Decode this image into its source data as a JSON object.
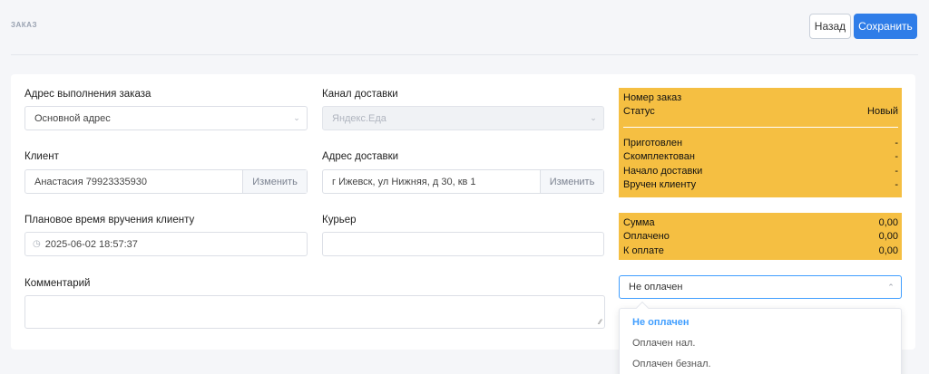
{
  "page": {
    "title": "ЗАКАЗ"
  },
  "actions": {
    "back_label": "Назад",
    "save_label": "Сохранить"
  },
  "form": {
    "fulfillment_address": {
      "label": "Адрес выполнения заказа",
      "value": "Основной адрес"
    },
    "delivery_channel": {
      "label": "Канал доставки",
      "value": "Яндекс.Еда"
    },
    "client": {
      "label": "Клиент",
      "value": "Анастасия 79923335930",
      "change_label": "Изменить"
    },
    "delivery_address": {
      "label": "Адрес доставки",
      "value": "г Ижевск, ул Нижняя, д 30, кв 1",
      "change_label": "Изменить"
    },
    "planned_time": {
      "label": "Плановое время вручения клиенту",
      "value": "2025-06-02 18:57:37"
    },
    "courier": {
      "label": "Курьер",
      "value": ""
    },
    "comment": {
      "label": "Комментарий",
      "value": ""
    }
  },
  "status_panel": {
    "order_number_label": "Номер заказ",
    "status_label": "Статус",
    "status_value": "Новый",
    "stages": [
      {
        "label": "Приготовлен",
        "value": "-"
      },
      {
        "label": "Скомплектован",
        "value": "-"
      },
      {
        "label": "Начало доставки",
        "value": "-"
      },
      {
        "label": "Вручен клиенту",
        "value": "-"
      }
    ]
  },
  "totals": [
    {
      "label": "Сумма",
      "value": "0,00"
    },
    {
      "label": "Оплачено",
      "value": "0,00"
    },
    {
      "label": "К оплате",
      "value": "0,00"
    }
  ],
  "payment": {
    "selected": "Не оплачен",
    "options": [
      "Не оплачен",
      "Оплачен нал.",
      "Оплачен безнал."
    ]
  },
  "colors": {
    "accent": "#2f7de8",
    "panel": "#f5bf42",
    "select_focus": "#409eff"
  }
}
